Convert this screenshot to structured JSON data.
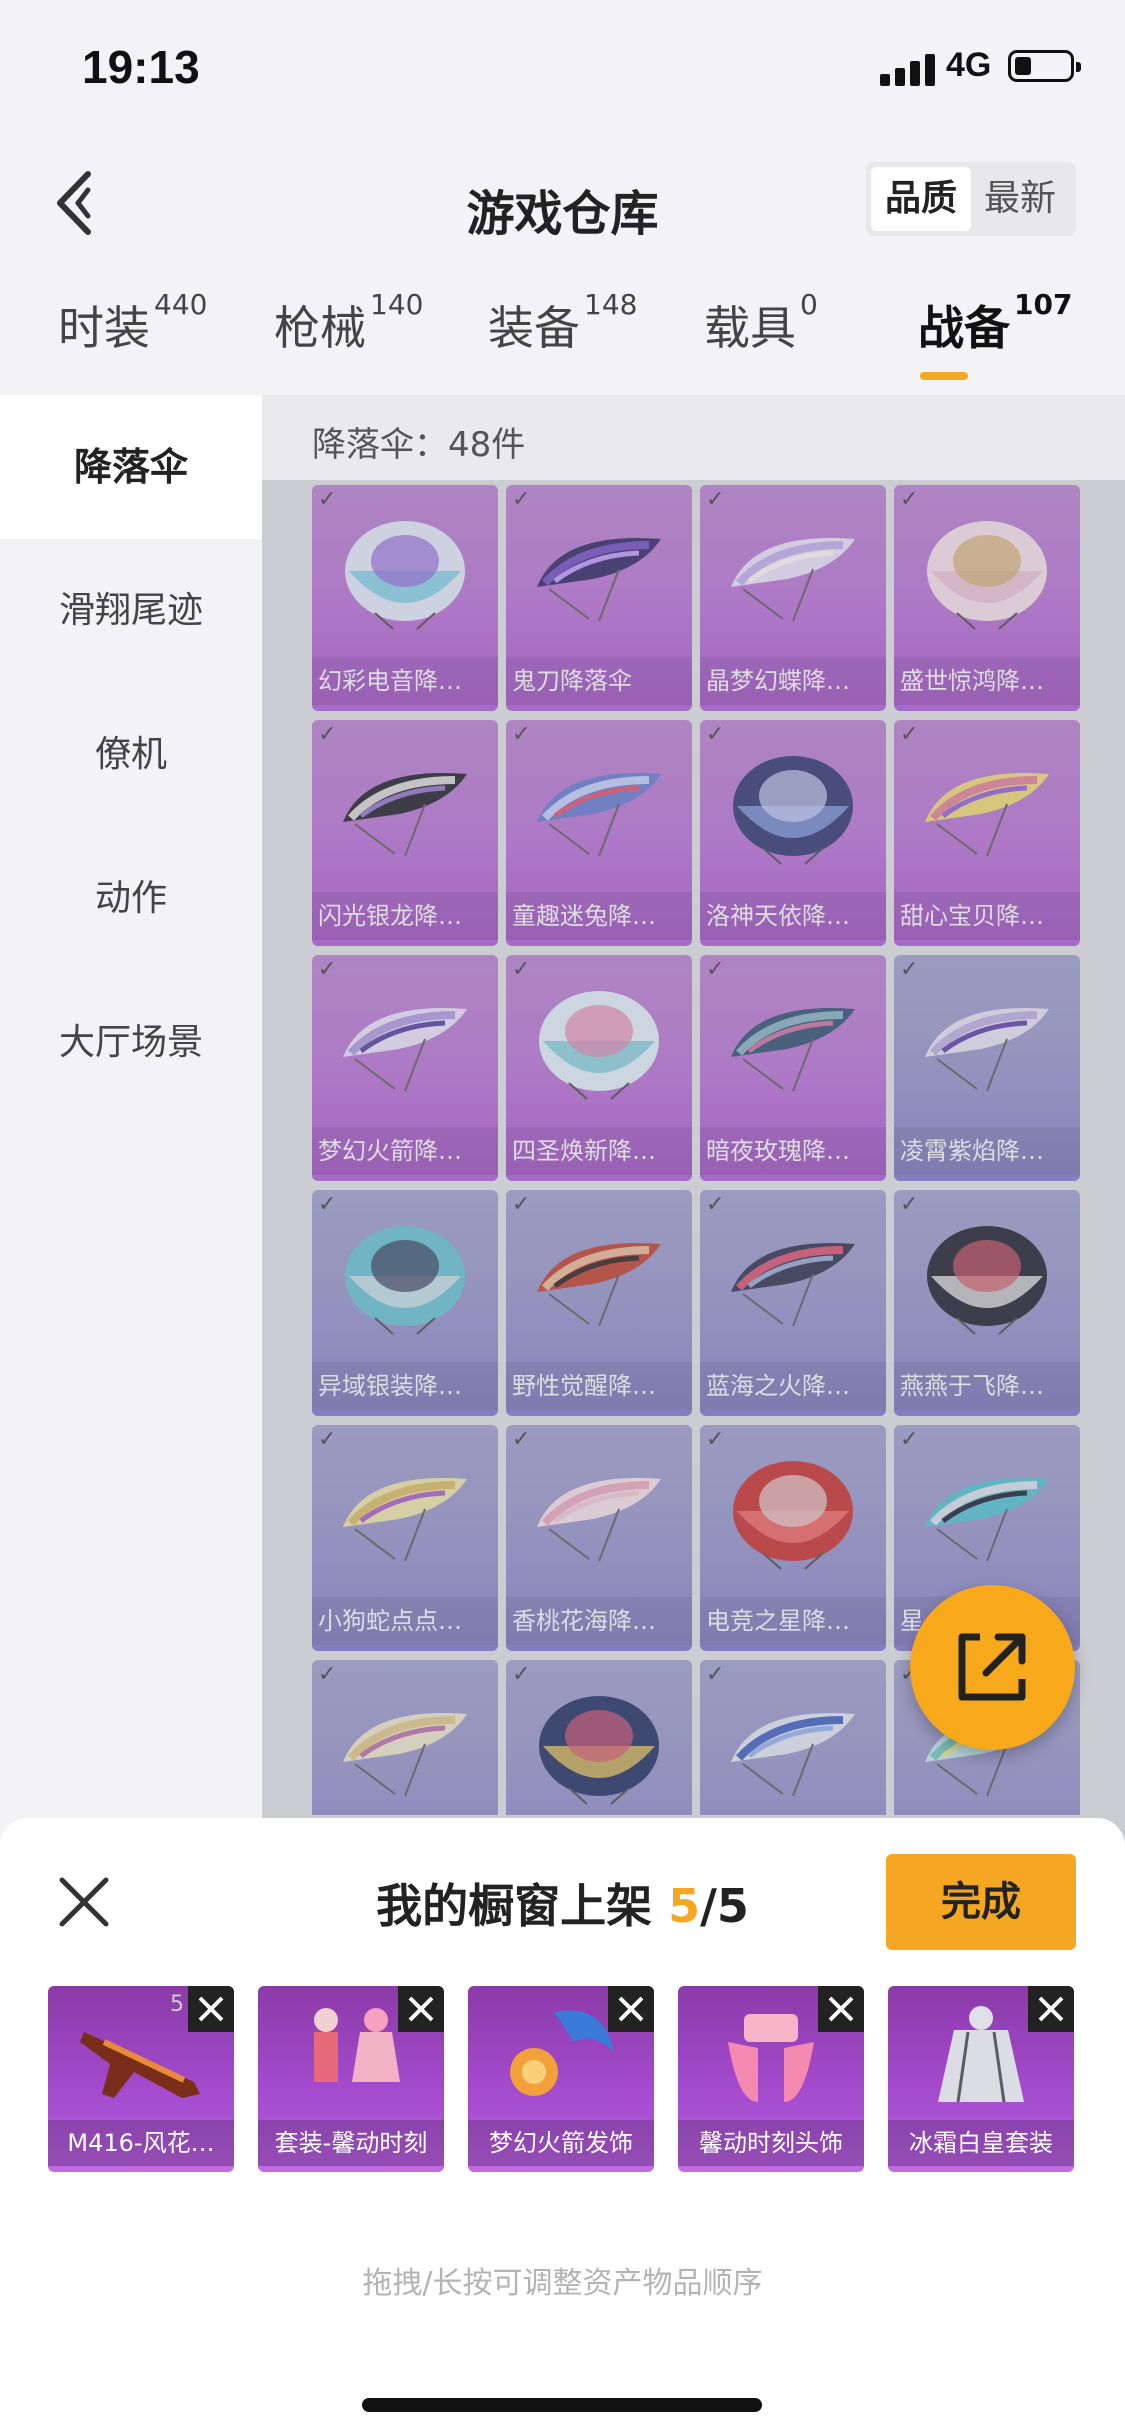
{
  "status_bar": {
    "time": "19:13",
    "network": "4G"
  },
  "header": {
    "title": "游戏仓库",
    "sort": {
      "options": [
        "品质",
        "最新"
      ],
      "selected": "品质"
    }
  },
  "tabs": [
    {
      "label": "时装",
      "count": "440"
    },
    {
      "label": "枪械",
      "count": "140"
    },
    {
      "label": "装备",
      "count": "148"
    },
    {
      "label": "载具",
      "count": "0"
    },
    {
      "label": "战备",
      "count": "107",
      "active": true
    }
  ],
  "sidebar": {
    "items": [
      "降落伞",
      "滑翔尾迹",
      "僚机",
      "动作",
      "大厅场景"
    ],
    "active": "降落伞"
  },
  "main": {
    "count_label": "降落伞：48件",
    "items": [
      {
        "name": "幻彩电音降…",
        "rarity": "purple"
      },
      {
        "name": "鬼刀降落伞",
        "rarity": "purple"
      },
      {
        "name": "晶梦幻蝶降…",
        "rarity": "purple"
      },
      {
        "name": "盛世惊鸿降…",
        "rarity": "purple"
      },
      {
        "name": "闪光银龙降…",
        "rarity": "purple"
      },
      {
        "name": "童趣迷兔降…",
        "rarity": "purple"
      },
      {
        "name": "洛神天依降…",
        "rarity": "purple"
      },
      {
        "name": "甜心宝贝降…",
        "rarity": "purple"
      },
      {
        "name": "梦幻火箭降…",
        "rarity": "purple"
      },
      {
        "name": "四圣焕新降…",
        "rarity": "purple"
      },
      {
        "name": "暗夜玫瑰降…",
        "rarity": "purple"
      },
      {
        "name": "凌霄紫焰降…",
        "rarity": "blue"
      },
      {
        "name": "异域银装降…",
        "rarity": "blue"
      },
      {
        "name": "野性觉醒降…",
        "rarity": "blue"
      },
      {
        "name": "蓝海之火降…",
        "rarity": "blue"
      },
      {
        "name": "燕燕于飞降…",
        "rarity": "blue"
      },
      {
        "name": "小狗蛇点点…",
        "rarity": "blue"
      },
      {
        "name": "香桃花海降…",
        "rarity": "blue"
      },
      {
        "name": "电竞之星降…",
        "rarity": "blue"
      },
      {
        "name": "星…",
        "rarity": "blue"
      },
      {
        "name": "",
        "rarity": "blue"
      },
      {
        "name": "",
        "rarity": "blue"
      },
      {
        "name": "",
        "rarity": "blue"
      },
      {
        "name": "",
        "rarity": "blue"
      }
    ]
  },
  "showcase": {
    "title": "我的橱窗上架",
    "count": "5",
    "total": "/5",
    "done_label": "完成",
    "items": [
      "M416-风花…",
      "套装-馨动时刻",
      "梦幻火箭发饰",
      "馨动时刻头饰",
      "冰霜白皇套装"
    ],
    "first_badge": "5",
    "hint": "拖拽/长按可调整资产物品顺序"
  },
  "colors": {
    "accent": "#f5a623",
    "purple_card": "#c079dc",
    "blue_card": "#9d9bd2"
  },
  "icons": [
    "back-arrow-icon",
    "check-icon",
    "share-icon",
    "close-icon",
    "remove-icon"
  ]
}
